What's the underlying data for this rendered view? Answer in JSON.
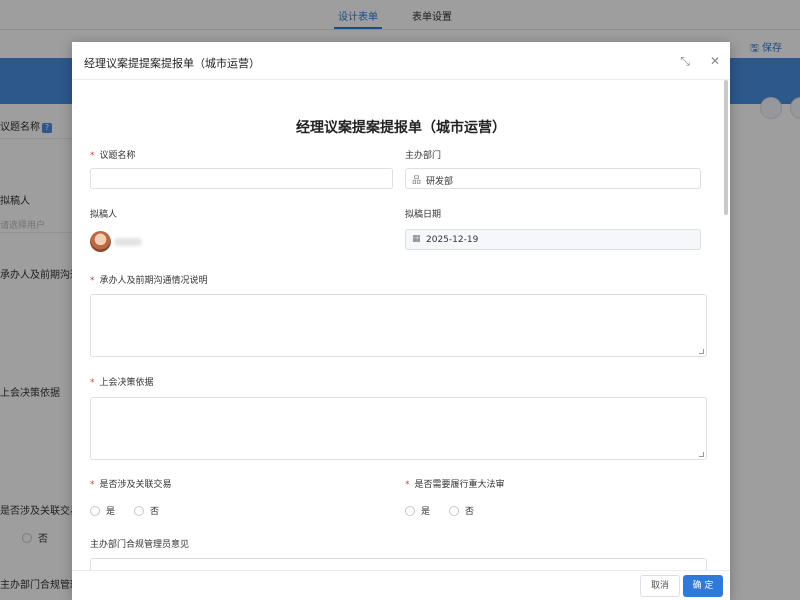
{
  "top_tabs": [
    {
      "label": "设计表单",
      "active": true
    },
    {
      "label": "表单设置",
      "active": false
    }
  ],
  "toolbar": {
    "save_label": "保存"
  },
  "background": {
    "field_title": "议题名称",
    "drafter": "拟稿人",
    "drafter_hint": "请选择用户",
    "handler": "承办人及前期沟通情",
    "basis": "上会决策依据",
    "related": "是否涉及关联交易",
    "radio_no": "否",
    "bottom": "主办部门合规管理员意"
  },
  "modal": {
    "title": "经理议案提提案提报单（城市运营）",
    "form_title": "经理议案提案提报单（城市运营）",
    "fields": {
      "topic": {
        "label": "议题名称",
        "required": true,
        "value": ""
      },
      "dept": {
        "label": "主办部门",
        "value": "研发部",
        "icon": "org-icon"
      },
      "drafter": {
        "label": "拟稿人"
      },
      "date": {
        "label": "拟稿日期",
        "value": "2025-12-19",
        "icon": "calendar-icon"
      },
      "handler_note": {
        "label": "承办人及前期沟通情况说明",
        "required": true
      },
      "basis": {
        "label": "上会决策依据",
        "required": true
      },
      "related_trade": {
        "label": "是否涉及关联交易",
        "required": true,
        "options": [
          "是",
          "否"
        ]
      },
      "legal_review": {
        "label": "是否需要履行重大法审",
        "required": true,
        "options": [
          "是",
          "否"
        ]
      },
      "compliance": {
        "label": "主办部门合规管理员意见"
      }
    },
    "footer": {
      "cancel": "取消",
      "confirm": "确 定"
    }
  },
  "colors": {
    "accent": "#2f7ad9",
    "required": "#e03c3c",
    "band": "#4a8ee0"
  }
}
